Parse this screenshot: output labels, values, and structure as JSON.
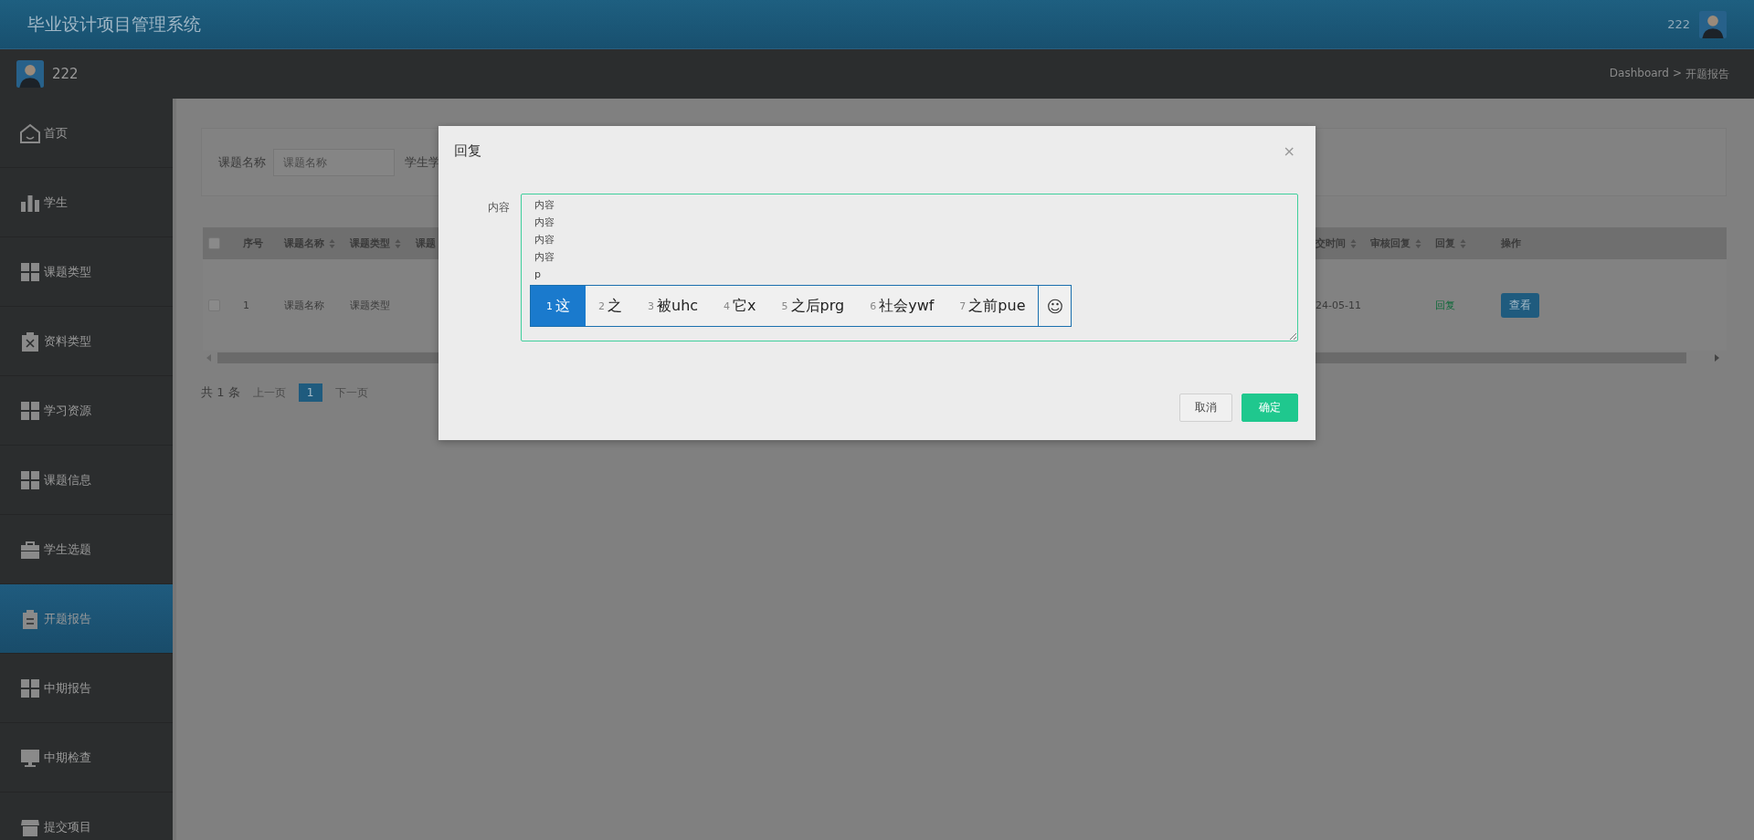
{
  "header": {
    "title": "毕业设计项目管理系统",
    "user": "222"
  },
  "subbar": {
    "user": "222",
    "breadcrumb": [
      {
        "label": "Dashboard"
      },
      {
        "label": ">"
      },
      {
        "label": "开题报告"
      }
    ]
  },
  "sidebar": {
    "items": [
      {
        "label": "首页",
        "selected": false
      },
      {
        "label": "学生",
        "selected": false
      },
      {
        "label": "课题类型",
        "selected": false
      },
      {
        "label": "资料类型",
        "selected": false
      },
      {
        "label": "学习资源",
        "selected": false
      },
      {
        "label": "课题信息",
        "selected": false
      },
      {
        "label": "学生选题",
        "selected": false
      },
      {
        "label": "开题报告",
        "selected": true
      },
      {
        "label": "中期报告",
        "selected": false
      },
      {
        "label": "中期检查",
        "selected": false
      },
      {
        "label": "提交项目",
        "selected": false
      }
    ]
  },
  "search": {
    "label": "课题名称",
    "placeholder": "课题名称",
    "next_label": "学生学"
  },
  "table": {
    "all_checked": false,
    "columns": [
      {
        "label": "序号",
        "sortable": false
      },
      {
        "label": "课题名称",
        "sortable": true
      },
      {
        "label": "课题类型",
        "sortable": true
      },
      {
        "label": "课题"
      },
      {
        "label": "交时间",
        "sortable": true
      },
      {
        "label": "审核回复",
        "sortable": true
      },
      {
        "label": "回复",
        "sortable": true
      },
      {
        "label": "操作",
        "sortable": false
      }
    ],
    "rows": [
      {
        "checked": false,
        "cells": [
          "1",
          "课题名称",
          "课题类型",
          "",
          "24-05-11",
          "",
          "回复"
        ],
        "action": "查看"
      }
    ]
  },
  "pagination": {
    "total": "共 1 条",
    "prev": "上一页",
    "pages": [
      {
        "label": "1",
        "selected": true
      }
    ],
    "next": "下一页"
  },
  "dialog": {
    "title": "回复",
    "close": "×",
    "field_label": "内容",
    "lines": [
      "内容",
      "内容",
      "内容",
      "内容",
      "p"
    ],
    "ime": {
      "candidates": [
        {
          "number": "1",
          "text": "这",
          "selected": true
        },
        {
          "number": "2",
          "text": "之",
          "selected": false
        },
        {
          "number": "3",
          "text": "被uhc",
          "selected": false
        },
        {
          "number": "4",
          "text": "它x",
          "selected": false
        },
        {
          "number": "5",
          "text": "之后prg",
          "selected": false
        },
        {
          "number": "6",
          "text": "社会ywf",
          "selected": false
        },
        {
          "number": "7",
          "text": "之前pue",
          "selected": false
        }
      ],
      "emoji": "☺"
    },
    "buttons": [
      {
        "label": "取消",
        "kind": "secondary"
      },
      {
        "label": "确定",
        "kind": "primary"
      }
    ]
  }
}
